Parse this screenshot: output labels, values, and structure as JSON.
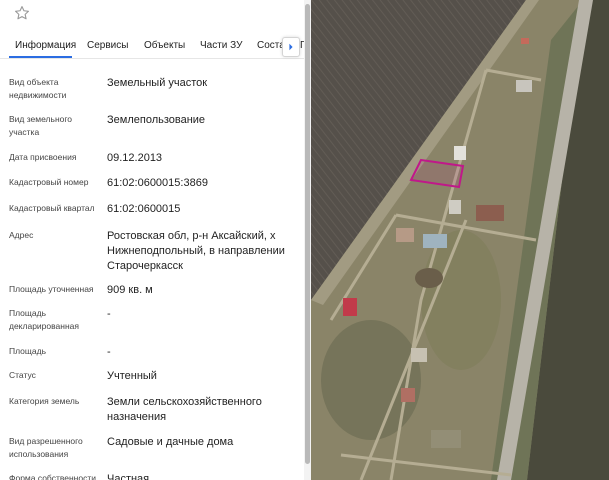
{
  "tabs": [
    {
      "label": "Информация",
      "active": true
    },
    {
      "label": "Сервисы",
      "active": false
    },
    {
      "label": "Объекты",
      "active": false
    },
    {
      "label": "Части ЗУ",
      "active": false
    },
    {
      "label": "Соста",
      "active": false
    },
    {
      "label": "П",
      "active": false
    }
  ],
  "fields": [
    {
      "label": "Вид объекта недвижимости",
      "value": "Земельный участок"
    },
    {
      "label": "Вид земельного участка",
      "value": "Землепользование"
    },
    {
      "label": "Дата присвоения",
      "value": "09.12.2013"
    },
    {
      "label": "Кадастровый номер",
      "value": "61:02:0600015:3869"
    },
    {
      "label": "Кадастровый квартал",
      "value": "61:02:0600015"
    },
    {
      "label": "Адрес",
      "value": "Ростовская обл, р-н Аксайский, х Нижнеподпольный, в направлении Старочеркасск"
    },
    {
      "label": "Площадь уточненная",
      "value": "909 кв. м"
    },
    {
      "label": "Площадь декларированная",
      "value": "-"
    },
    {
      "label": "Площадь",
      "value": "-"
    },
    {
      "label": "Статус",
      "value": "Учтенный"
    },
    {
      "label": "Категория земель",
      "value": "Земли сельскохозяйственного назначения"
    },
    {
      "label": "Вид разрешенного использования",
      "value": "Садовые и дачные дома"
    },
    {
      "label": "Форма собственности",
      "value": "Частная"
    }
  ],
  "colors": {
    "accent": "#2b6de2",
    "parcel_outline": "#c0188a"
  },
  "icons": {
    "favorite": "star-icon",
    "tabs_next": "chevron-right-icon"
  }
}
